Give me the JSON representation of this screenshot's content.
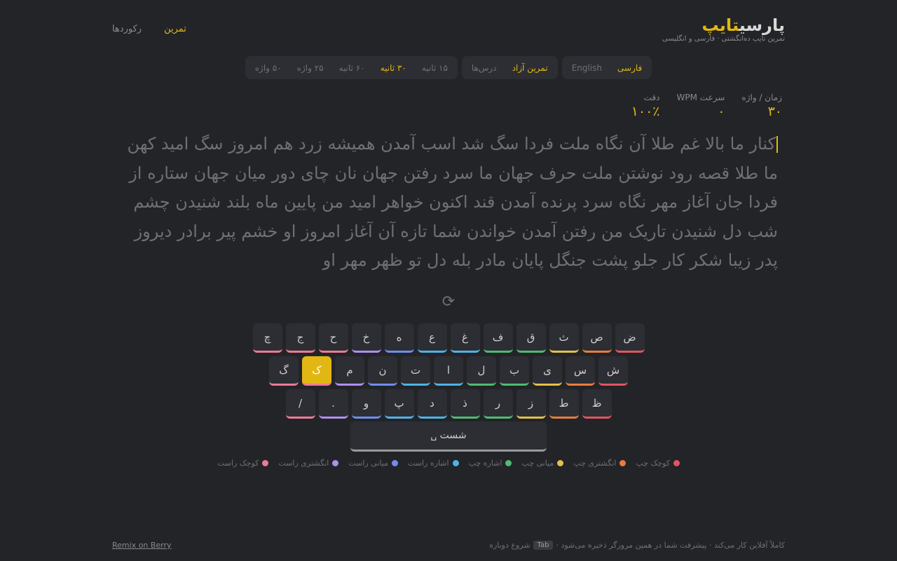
{
  "brand": {
    "logo_main": "پارسی",
    "logo_accent": "تایپ",
    "tagline": "تمرین تایپ ده‌انگشتی · فارسی و انگلیسی"
  },
  "nav": {
    "practice": "تمرین",
    "records": "رکوردها"
  },
  "modes": {
    "language": [
      "فارسی",
      "English"
    ],
    "type": [
      "تمرین آزاد",
      "درس‌ها"
    ],
    "duration": [
      "۱۵ ثانیه",
      "۳۰ ثانیه",
      "۶۰ ثانیه",
      "۲۵ واژه",
      "۵۰ واژه"
    ],
    "selected": {
      "language": "فارسی",
      "type": "تمرین آزاد",
      "duration": "۳۰ ثانیه"
    }
  },
  "stats": [
    {
      "label": "زمان / واژه",
      "value": "۳۰"
    },
    {
      "label": "سرعت WPM",
      "value": "۰"
    },
    {
      "label": "دقت",
      "value": "۱۰۰٪"
    }
  ],
  "words": "کنار ما بالا غم طلا آن نگاه ملت فردا سگ شد اسب آمدن همیشه زرد هم امروز سگ امید کهن ما طلا قصه رود نوشتن ملت حرف جهان ما سرد رفتن جهان نان چای دور میان جهان ستاره از فردا جان آغاز مهر نگاه سرد پرنده آمدن قند اکنون خواهر امید من پایین ماه بلند شنیدن چشم شب دل شنیدن تاریک من رفتن آمدن خواندن شما تازه آن آغاز امروز او خشم پیر برادر دیروز پدر زیبا شکر کار جلو پشت جنگل پایان مادر بله دل تو ظهر مهر او",
  "restart_icon": "⟳",
  "keyboard": {
    "rows": [
      [
        {
          "k": "ض",
          "f": "lp"
        },
        {
          "k": "ص",
          "f": "lr"
        },
        {
          "k": "ث",
          "f": "lm"
        },
        {
          "k": "ق",
          "f": "li"
        },
        {
          "k": "ف",
          "f": "li"
        },
        {
          "k": "غ",
          "f": "ri"
        },
        {
          "k": "ع",
          "f": "ri"
        },
        {
          "k": "ه",
          "f": "rm"
        },
        {
          "k": "خ",
          "f": "rr"
        },
        {
          "k": "ح",
          "f": "rp"
        },
        {
          "k": "ج",
          "f": "rp"
        },
        {
          "k": "چ",
          "f": "rp"
        }
      ],
      [
        {
          "k": "ش",
          "f": "lp"
        },
        {
          "k": "س",
          "f": "lr"
        },
        {
          "k": "ی",
          "f": "lm"
        },
        {
          "k": "ب",
          "f": "li"
        },
        {
          "k": "ل",
          "f": "li"
        },
        {
          "k": "ا",
          "f": "ri"
        },
        {
          "k": "ت",
          "f": "ri"
        },
        {
          "k": "ن",
          "f": "rm"
        },
        {
          "k": "م",
          "f": "rr"
        },
        {
          "k": "ک",
          "f": "rp",
          "active": true
        },
        {
          "k": "گ",
          "f": "rp"
        }
      ],
      [
        {
          "k": "ظ",
          "f": "lp"
        },
        {
          "k": "ط",
          "f": "lr"
        },
        {
          "k": "ز",
          "f": "lm"
        },
        {
          "k": "ر",
          "f": "li"
        },
        {
          "k": "ذ",
          "f": "li"
        },
        {
          "k": "د",
          "f": "ri"
        },
        {
          "k": "پ",
          "f": "ri"
        },
        {
          "k": "و",
          "f": "rm"
        },
        {
          "k": ".",
          "f": "rr"
        },
        {
          "k": "/",
          "f": "rp"
        }
      ]
    ],
    "space": "شست ␣"
  },
  "fingers": [
    {
      "id": "lp",
      "label": "کوچک چپ",
      "color": "#e05561"
    },
    {
      "id": "lr",
      "label": "انگشتری چپ",
      "color": "#e87d3e"
    },
    {
      "id": "lm",
      "label": "میانی چپ",
      "color": "#e2c14a"
    },
    {
      "id": "li",
      "label": "اشاره چپ",
      "color": "#4fbb73"
    },
    {
      "id": "ri",
      "label": "اشاره راست",
      "color": "#4fb3e8"
    },
    {
      "id": "rm",
      "label": "میانی راست",
      "color": "#6f8ef0"
    },
    {
      "id": "rr",
      "label": "انگشتری راست",
      "color": "#b08ef0"
    },
    {
      "id": "rp",
      "label": "کوچک راست",
      "color": "#ee7a95"
    }
  ],
  "footer": {
    "note_before": "کاملاً آفلاین کار می‌کند · پیشرفت شما در همین مرورگر ذخیره می‌شود ·",
    "key": "Tab",
    "note_after": "شروع دوباره",
    "remix": "Remix on Berry"
  }
}
